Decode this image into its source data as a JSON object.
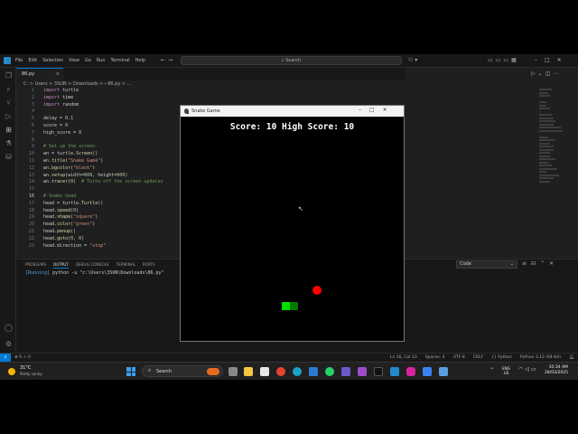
{
  "menu": [
    "File",
    "Edit",
    "Selection",
    "View",
    "Go",
    "Run",
    "Terminal",
    "Help"
  ],
  "search_placeholder": "Search",
  "tab": {
    "filename": "86.py",
    "close": "×"
  },
  "breadcrumb": "C: > Users > 3SUN > Downloads > ⬩ 86.py > ...",
  "code": [
    "import turtle",
    "import time",
    "import random",
    "",
    "delay = 0.1",
    "score = 0",
    "high_score = 0",
    "",
    "# Set up the screen",
    "wn = turtle.Screen()",
    "wn.title(\"Snake Game\")",
    "wn.bgcolor(\"black\")",
    "wn.setup(width=600, height=600)",
    "wn.tracer(0)  # Turns off the screen updates",
    "",
    "# Snake head",
    "head = turtle.Turtle()",
    "head.speed(0)",
    "head.shape(\"square\")",
    "head.color(\"green\")",
    "head.penup()",
    "head.goto(0, 0)",
    "head.direction = \"stop\""
  ],
  "panel": {
    "tabs": [
      "PROBLEMS",
      "OUTPUT",
      "DEBUG CONSOLE",
      "TERMINAL",
      "PORTS"
    ],
    "active_tab": "OUTPUT",
    "output_select": "Code",
    "running": "[Running]",
    "command": "python -u \"c:\\Users\\3SUN\\Downloads\\86.py\""
  },
  "statusbar": {
    "problems": "⊗ 0 ⚠ 0",
    "position": "Ln 16, Col 13",
    "spaces": "Spaces: 4",
    "encoding": "UTF-8",
    "eol": "CRLF",
    "language": "{} Python",
    "interpreter": "Python 3.12 (64-bit)"
  },
  "game": {
    "title": "Snake Game",
    "score_label": "Score: 10  High Score: 10"
  },
  "taskbar": {
    "temp": "31°C",
    "weather": "Partly sunny",
    "search": "Search",
    "lang_line1": "ENG",
    "lang_line2": "US",
    "time": "10:34 AM",
    "date": "28/03/2025"
  },
  "colors": {
    "accent": "#0078d4",
    "snake_head": "#00dd00",
    "snake_body": "#007a00",
    "food": "#ff0000"
  }
}
